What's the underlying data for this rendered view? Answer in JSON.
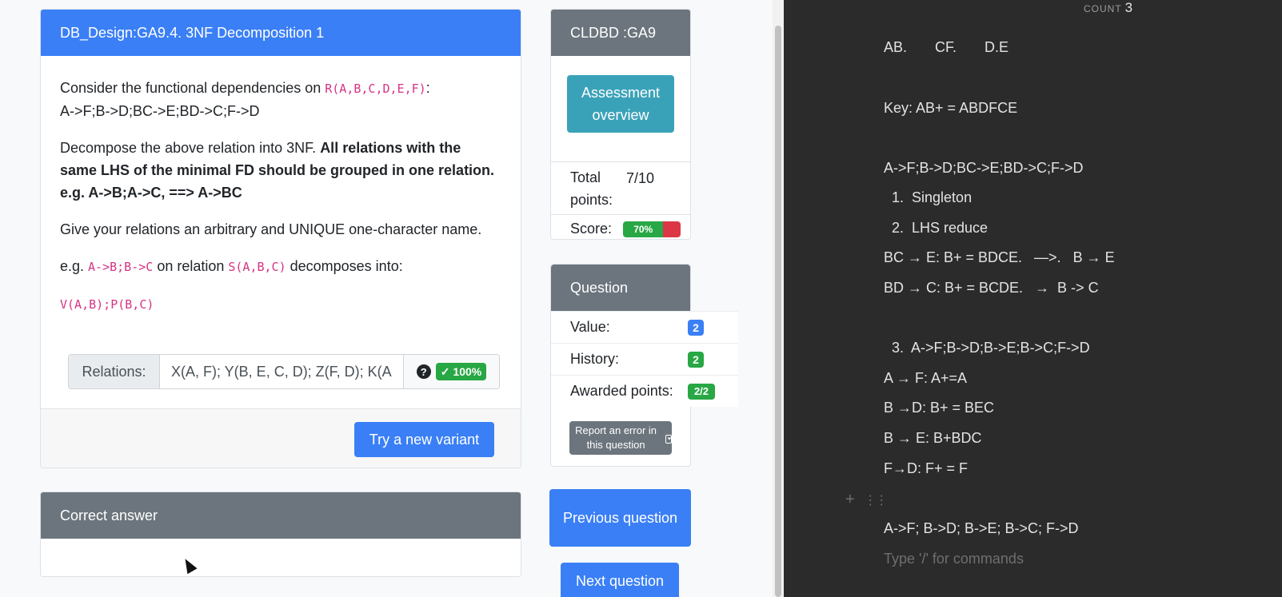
{
  "question_card": {
    "title": "DB_Design:GA9.4. 3NF Decomposition 1",
    "p1_text": "Consider the functional dependencies on ",
    "p1_code": "R(A,B,C,D,E,F)",
    "p1_colon": ":",
    "p1_fds": "A->F;B->D;BC->E;BD->C;F->D",
    "p2_text": "Decompose the above relation into 3NF. ",
    "p2_bold": "All relations with the same LHS of the minimal FD should be grouped in one relation. e.g. A->B;A->C, ==> A->BC",
    "p3_text": "Give your relations an arbitrary and UNIQUE one-character name.",
    "p4_eg": "e.g. ",
    "p4_code1": "A->B;B->C",
    "p4_mid": " on relation ",
    "p4_code2": "S(A,B,C)",
    "p4_end": " decomposes into:",
    "p5_code": "V(A,B);P(B,C)",
    "relations_label": "Relations:",
    "relations_value": "X(A, F); Y(B, E, C, D); Z(F, D); K(A",
    "help_icon_glyph": "?",
    "status_badge": "✓ 100%",
    "try_button": "Try a new variant"
  },
  "correct_answer": {
    "title": "Correct answer"
  },
  "assessment_card": {
    "title": "CLDBD :GA9",
    "overview_button": "Assessment overview",
    "total_points_label": "Total points:",
    "total_points_value": "7/10",
    "score_label": "Score:",
    "score_percent": "70%",
    "score_fraction": 0.7
  },
  "question_card_side": {
    "title": "Question",
    "value_label": "Value:",
    "value_badge": "2",
    "history_label": "History:",
    "history_badge": "2",
    "awarded_label": "Awarded points:",
    "awarded_badge": "2/2",
    "report_button": "Report an error in this question",
    "report_icon": "caret-square-down-icon"
  },
  "navigation": {
    "previous_button": "Previous question",
    "next_button": "Next question"
  },
  "notes": {
    "count_label": "COUNT",
    "count_value": "3",
    "lines": [
      "AB.       CF.       D.E",
      "Key: AB+ = ABDFCE",
      "A->F;B->D;BC->E;BD->C;F->D",
      "  1.  Singleton",
      "  2.  LHS reduce",
      "BC → E: B+ = BDCE.   —>.   B → E",
      "BD → C: B+ = BCDE.   →  B -> C",
      "  3.  A->F;B->D;B->E;B->C;F->D",
      "A → F: A+=A",
      "B →D: B+ = BEC",
      "B → E: B+BDC",
      "F→D: F+ = F",
      "A->F; B->D; B->E; B->C; F->D"
    ],
    "placeholder": "Type '/' for commands"
  },
  "colors": {
    "primary": "#3a7ff6",
    "success": "#28a745",
    "danger": "#dc3545",
    "info": "#3aa2b8",
    "secondary": "#6c757d",
    "code_pink": "#d63384",
    "notes_bg": "#2b2b2b"
  }
}
